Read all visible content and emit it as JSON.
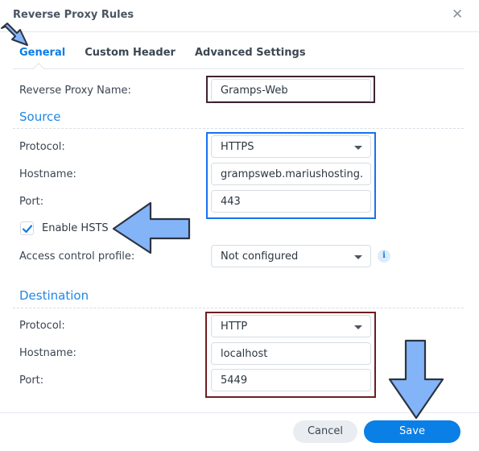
{
  "dialog": {
    "title": "Reverse Proxy Rules",
    "close_icon": "close-icon"
  },
  "tabs": [
    {
      "label": "General",
      "active": true
    },
    {
      "label": "Custom Header",
      "active": false
    },
    {
      "label": "Advanced Settings",
      "active": false
    }
  ],
  "general": {
    "name_label": "Reverse Proxy Name:",
    "name_value": "Gramps-Web"
  },
  "source": {
    "heading": "Source",
    "protocol_label": "Protocol:",
    "protocol_value": "HTTPS",
    "hostname_label": "Hostname:",
    "hostname_value": "grampsweb.mariushosting.",
    "port_label": "Port:",
    "port_value": "443",
    "hsts_label": "Enable HSTS",
    "hsts_checked": true,
    "access_label": "Access control profile:",
    "access_value": "Not configured",
    "info_icon": "i"
  },
  "destination": {
    "heading": "Destination",
    "protocol_label": "Protocol:",
    "protocol_value": "HTTP",
    "hostname_label": "Hostname:",
    "hostname_value": "localhost",
    "port_label": "Port:",
    "port_value": "5449"
  },
  "footer": {
    "cancel_label": "Cancel",
    "save_label": "Save"
  },
  "colors": {
    "accent": "#0a7fe6",
    "section_heading": "#1f87e5",
    "highlight_source": "#1672f0",
    "highlight_destination": "#6e1d20",
    "highlight_name": "#3e2233",
    "annotation_arrow": "#84b4f8"
  }
}
